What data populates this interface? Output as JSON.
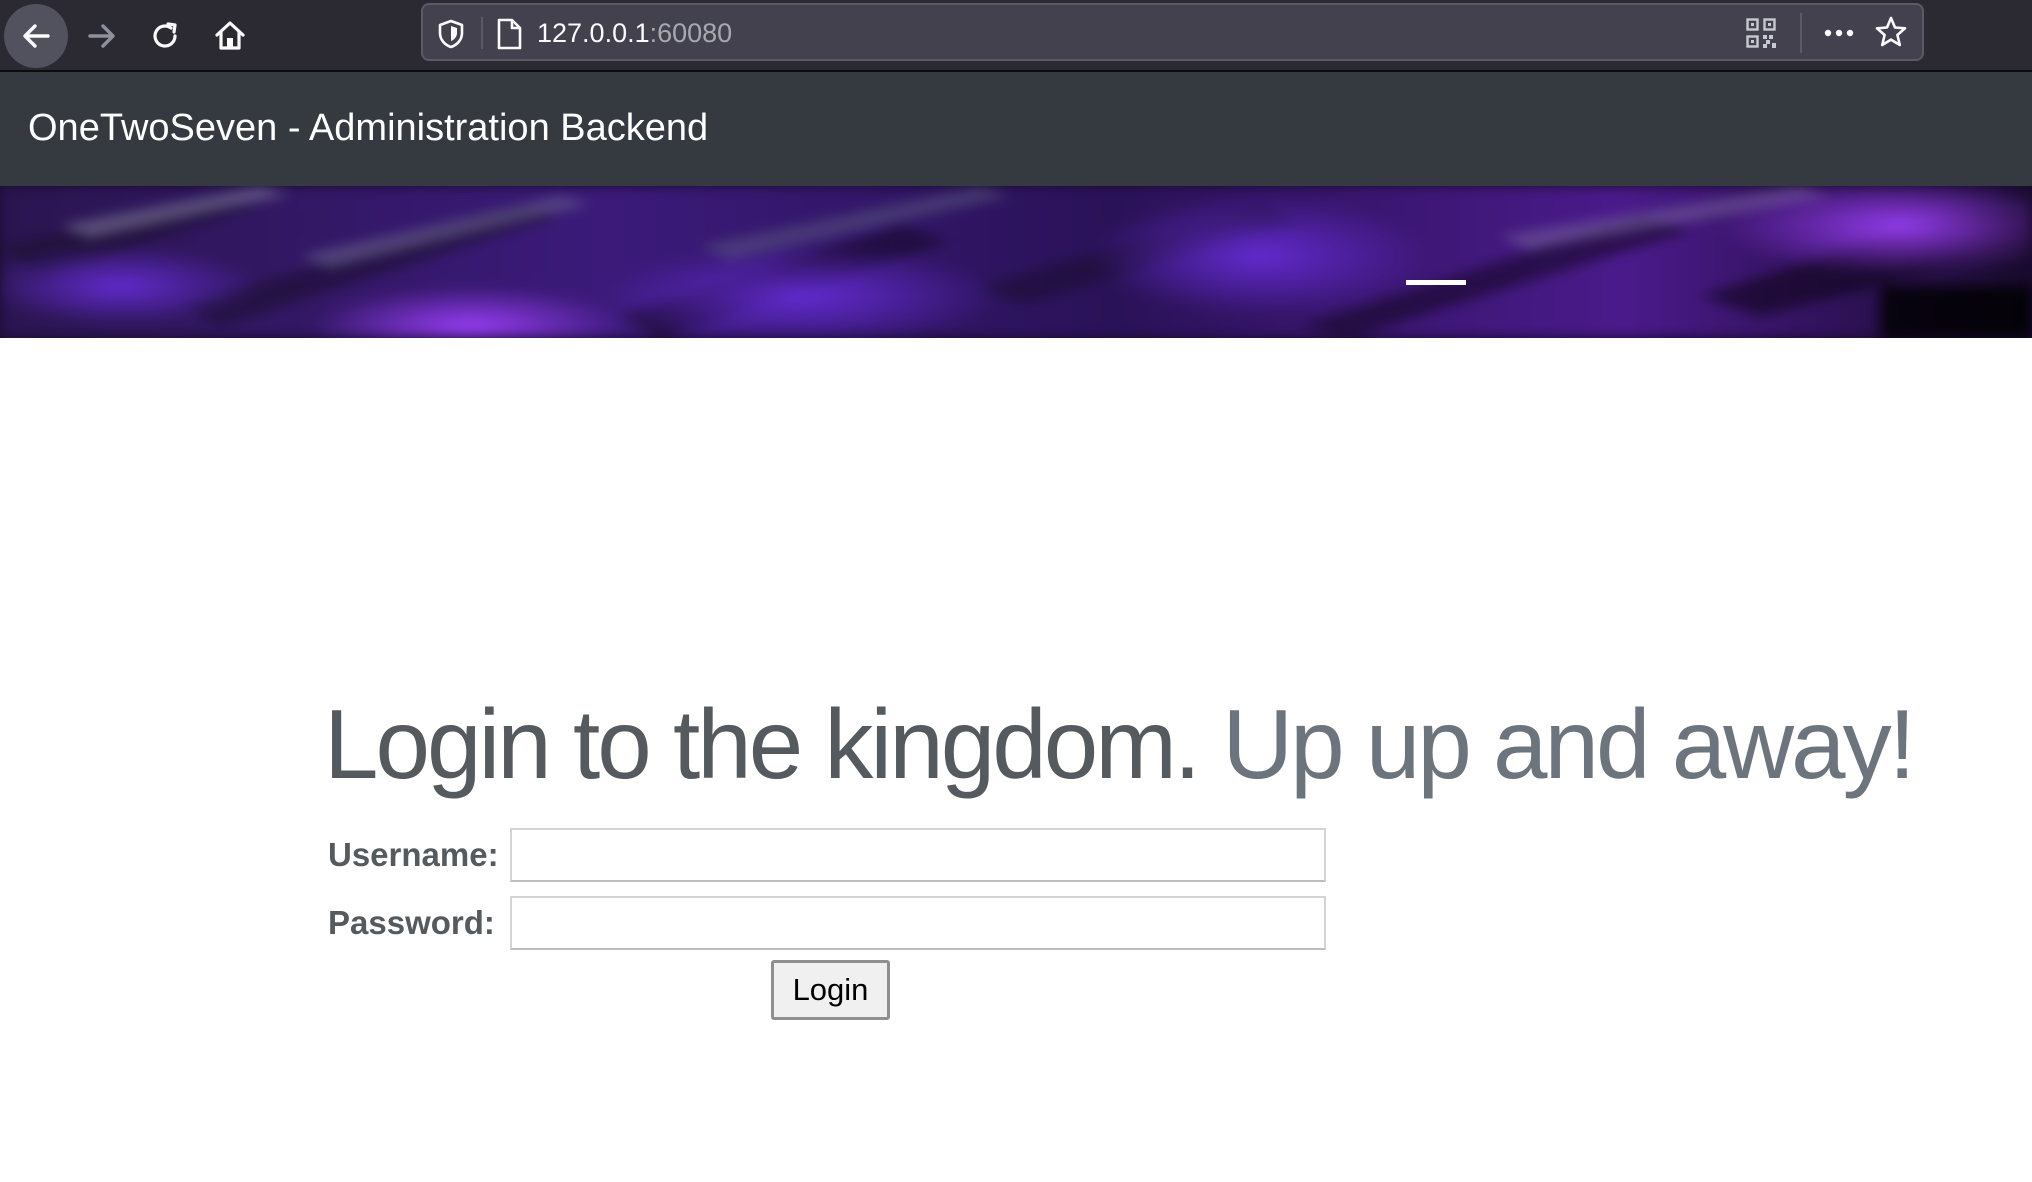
{
  "browser": {
    "url_host": "127.0.0.1",
    "url_port": ":60080",
    "icons": {
      "back": "back-arrow-icon",
      "forward": "forward-arrow-icon",
      "reload": "reload-icon",
      "home": "home-icon",
      "tracking_protection": "shield-icon",
      "page": "page-icon",
      "qr_code": "qr-code-icon",
      "more": "more-actions-icon",
      "bookmark": "star-icon"
    }
  },
  "site": {
    "brand": "OneTwoSeven - Administration Backend"
  },
  "login": {
    "heading_main": "Login to the kingdom.",
    "heading_muted": "Up up and away!",
    "username_label": "Username:",
    "username_value": "",
    "password_label": "Password:",
    "password_value": "",
    "button_label": "Login"
  },
  "colors": {
    "browser_chrome": "#2b2a33",
    "url_bar": "#42414d",
    "navbar": "#343a40",
    "heading_text": "#555a5f",
    "heading_muted": "#6c757d",
    "banner_purple": "#7b2bd9"
  }
}
